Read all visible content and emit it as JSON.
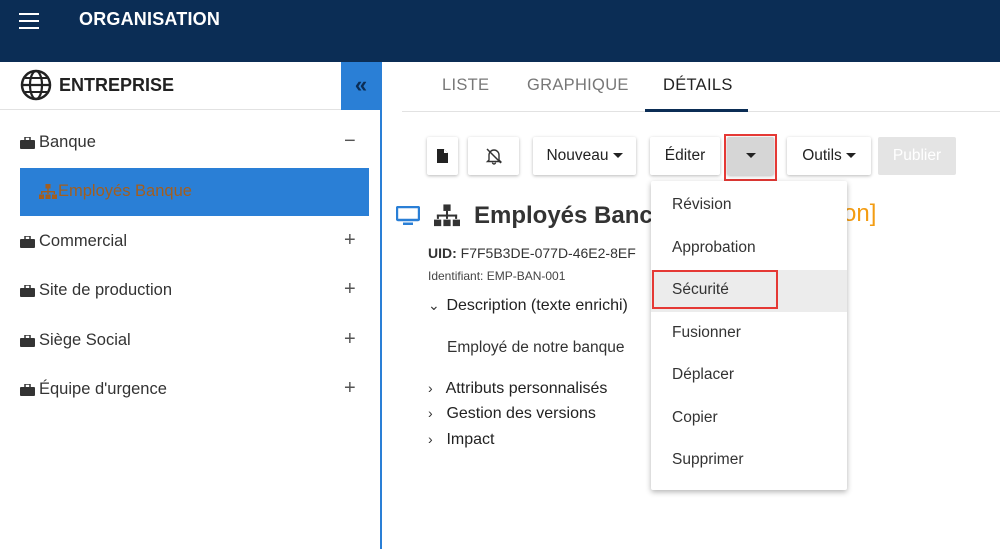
{
  "app": {
    "title": "ORGANISATION"
  },
  "sidebar": {
    "title": "ENTREPRISE",
    "collapse_label": "«",
    "items": [
      {
        "label": "Banque",
        "toggle": "−"
      },
      {
        "label": "Employés Banque",
        "selected": true
      },
      {
        "label": "Commercial",
        "toggle": "+"
      },
      {
        "label": "Site de production",
        "toggle": "+"
      },
      {
        "label": "Siège Social",
        "toggle": "+"
      },
      {
        "label": "Équipe d'urgence",
        "toggle": "+"
      }
    ]
  },
  "tabs": [
    {
      "label": "LISTE"
    },
    {
      "label": "GRAPHIQUE"
    },
    {
      "label": "DÉTAILS",
      "active": true
    }
  ],
  "toolbar": {
    "new_label": "Nouveau",
    "edit_label": "Éditer",
    "tools_label": "Outils",
    "publish_label": "Publier"
  },
  "detail": {
    "title": "Employés Banc",
    "title_suffix": "on]",
    "uid_label": "UID:",
    "uid_value": "F7F5B3DE-077D-46E2-8EF",
    "identifier": "Identifiant:  EMP-BAN-001",
    "description_header": "Description (texte enrichi)",
    "description_body": "Employé de notre banque",
    "sections": [
      "Attributs personnalisés",
      "Gestion des versions",
      "Impact"
    ]
  },
  "menu": {
    "items": [
      "Révision",
      "Approbation",
      "Sécurité",
      "Fusionner",
      "Déplacer",
      "Copier",
      "Supprimer"
    ],
    "highlighted": "Sécurité"
  },
  "colors": {
    "topbar": "#0b2d55",
    "accent": "#2a7fd6",
    "highlight_box": "#e53935",
    "title_suffix": "#f39c12"
  }
}
